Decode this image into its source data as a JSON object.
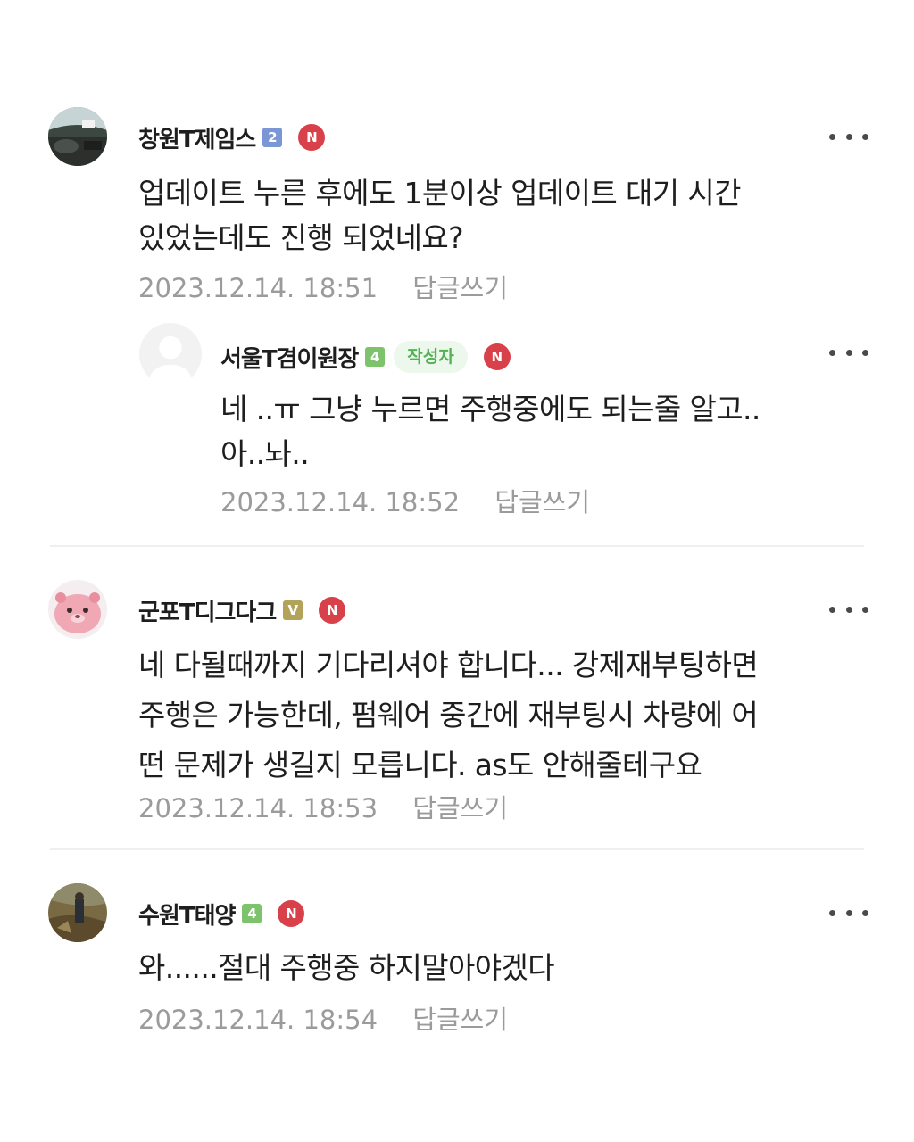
{
  "comments": [
    {
      "nickname": "창원T제임스",
      "level": "2",
      "level_color": "#7a96d6",
      "badge": "N",
      "text": "업데이트 누른 후에도 1분이상 업데이트 대기 시간\n있었는데도 진행 되었네요?",
      "date": "2023.12.14. 18:51",
      "reply_label": "답글쓰기",
      "avatar_icon": "car-interior-photo"
    },
    {
      "nickname": "서울T겸이원장",
      "level": "4",
      "level_color": "#7dc36b",
      "author_badge": "작성자",
      "badge": "N",
      "text": "네 ..ㅠ 그냥 누르면 주행중에도 되는줄 알고..\n아..놔..",
      "date": "2023.12.14. 18:52",
      "reply_label": "답글쓰기",
      "avatar_icon": "default-profile-icon"
    },
    {
      "nickname": "군포T디그다그",
      "level": "V",
      "level_color": "#b3a35a",
      "badge": "N",
      "text": "네 다될때까지 기다리셔야 합니다... 강제재부팅하면\n주행은 가능한데, 펌웨어 중간에 재부팅시 차량에 어\n떤 문제가 생길지 모릅니다. as도 안해줄테구요",
      "date": "2023.12.14. 18:53",
      "reply_label": "답글쓰기",
      "avatar_icon": "pink-beaver-character"
    },
    {
      "nickname": "수원T태양",
      "level": "4",
      "level_color": "#7dc36b",
      "badge": "N",
      "text": "와......절대 주행중 하지말아야겠다",
      "date": "2023.12.14. 18:54",
      "reply_label": "답글쓰기",
      "avatar_icon": "outdoor-photo"
    }
  ],
  "colors": {
    "text": "#1e1e1e",
    "meta": "#9b9b9b",
    "new_badge": "#d8414a",
    "author_badge_bg": "#ecf8ec",
    "author_badge_text": "#55b155",
    "divider": "#efefef"
  }
}
